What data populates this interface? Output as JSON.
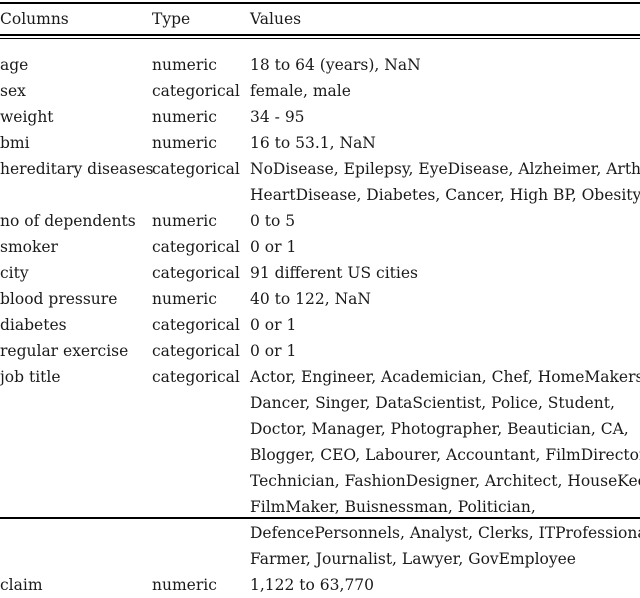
{
  "table": {
    "headers": {
      "columns": "Columns",
      "type": "Type",
      "values": "Values"
    },
    "rows": [
      {
        "name": "age",
        "type": "numeric",
        "value_lines": [
          "18 to 64 (years), NaN"
        ]
      },
      {
        "name": "sex",
        "type": "categorical",
        "value_lines": [
          "female, male"
        ]
      },
      {
        "name": "weight",
        "type": "numeric",
        "value_lines": [
          "34 - 95"
        ]
      },
      {
        "name": "bmi",
        "type": "numeric",
        "value_lines": [
          "16 to 53.1, NaN"
        ]
      },
      {
        "name": "hereditary diseases",
        "type": "categorical",
        "value_lines": [
          "NoDisease, Epilepsy, EyeDisease, Alzheimer, Arthritis,",
          "HeartDisease, Diabetes, Cancer, High BP, Obesity"
        ]
      },
      {
        "name": "no of dependents",
        "type": "numeric",
        "value_lines": [
          "0 to 5"
        ]
      },
      {
        "name": "smoker",
        "type": "categorical",
        "value_lines": [
          "0 or 1"
        ]
      },
      {
        "name": "city",
        "type": "categorical",
        "value_lines": [
          "91 different US cities"
        ]
      },
      {
        "name": "blood pressure",
        "type": "numeric",
        "value_lines": [
          "40 to 122, NaN"
        ]
      },
      {
        "name": "diabetes",
        "type": "categorical",
        "value_lines": [
          "0 or 1"
        ]
      },
      {
        "name": "regular exercise",
        "type": "categorical",
        "value_lines": [
          "0 or 1"
        ]
      },
      {
        "name": "job title",
        "type": "categorical",
        "value_lines": [
          "Actor, Engineer, Academician, Chef, HomeMakers,",
          "Dancer, Singer, DataScientist, Police, Student,",
          "Doctor, Manager, Photographer, Beautician, CA,",
          "Blogger, CEO, Labourer, Accountant, FilmDirector,",
          "Technician, FashionDesigner, Architect, HouseKeeper,",
          "FilmMaker, Buisnessman, Politician,",
          "DefencePersonnels, Analyst, Clerks, ITProfessional,",
          "Farmer, Journalist, Lawyer, GovEmployee"
        ]
      },
      {
        "name": "claim",
        "type": "numeric",
        "value_lines": [
          "1,122 to 63,770"
        ]
      }
    ]
  }
}
